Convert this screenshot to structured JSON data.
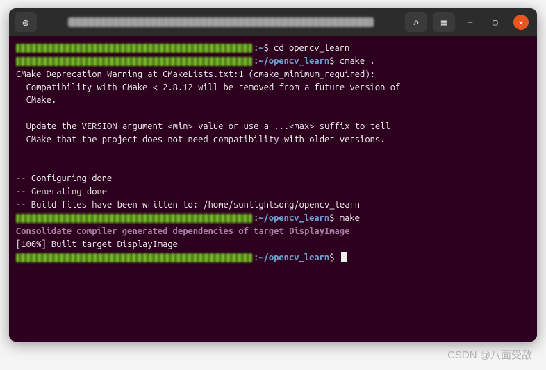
{
  "titlebar": {
    "new_tab_glyph": "⊕",
    "search_icon": "⌕",
    "menu_icon": "≡",
    "minimize_glyph": "—",
    "maximize_glyph": "▢",
    "close_glyph": "✕"
  },
  "terminal": {
    "lines": [
      {
        "type": "prompt",
        "path": ":~$",
        "cmd": " cd opencv_learn"
      },
      {
        "type": "prompt",
        "path": ":~/opencv_learn$",
        "cmd": " cmake ."
      },
      {
        "type": "out",
        "text": "CMake Deprecation Warning at CMakeLists.txt:1 (cmake_minimum_required):"
      },
      {
        "type": "out",
        "text": "  Compatibility with CMake < 2.8.12 will be removed from a future version of"
      },
      {
        "type": "out",
        "text": "  CMake."
      },
      {
        "type": "blank"
      },
      {
        "type": "out",
        "text": "  Update the VERSION argument <min> value or use a ...<max> suffix to tell"
      },
      {
        "type": "out",
        "text": "  CMake that the project does not need compatibility with older versions."
      },
      {
        "type": "blank"
      },
      {
        "type": "blank"
      },
      {
        "type": "out",
        "text": "-- Configuring done"
      },
      {
        "type": "out",
        "text": "-- Generating done"
      },
      {
        "type": "out",
        "text": "-- Build files have been written to: /home/sunlightsong/opencv_learn"
      },
      {
        "type": "prompt",
        "path": ":~/opencv_learn$",
        "cmd": " make"
      },
      {
        "type": "purple",
        "text": "Consolidate compiler generated dependencies of target DisplayImage"
      },
      {
        "type": "out",
        "text": "[100%] Built target DisplayImage"
      },
      {
        "type": "prompt-cursor",
        "path": ":~/opencv_learn$",
        "cmd": " "
      }
    ]
  },
  "watermark": "CSDN @八面受敌"
}
